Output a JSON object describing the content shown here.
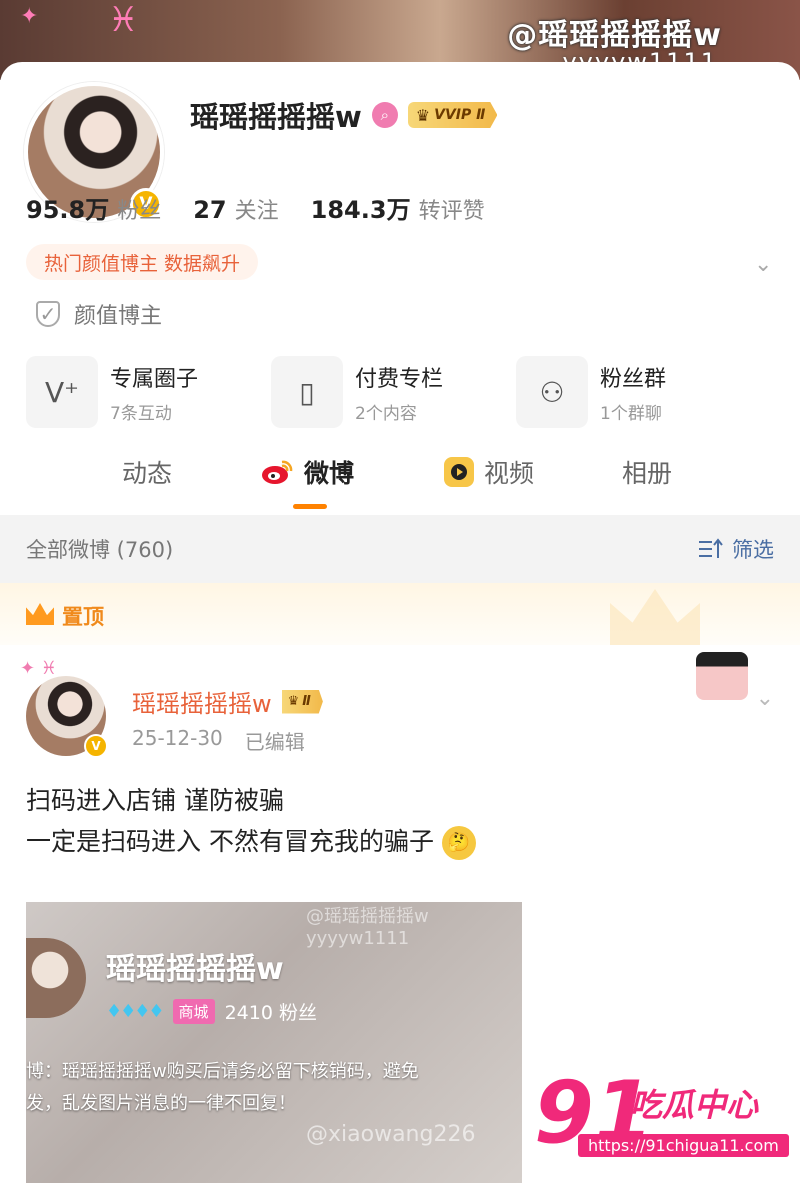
{
  "cover": {
    "watermark_handle": "@瑶瑶摇摇摇w",
    "watermark_id": "yyyyw1111"
  },
  "profile": {
    "name": "瑶瑶摇摇摇w",
    "verified_badge": "V",
    "vip_badge": "VVIP Ⅱ",
    "stats": [
      {
        "value": "95.8万",
        "label": "粉丝"
      },
      {
        "value": "27",
        "label": "关注"
      },
      {
        "value": "184.3万",
        "label": "转评赞"
      }
    ],
    "hot_tag": "热门颜值博主 数据飙升",
    "tagline": "颜值博主",
    "features": [
      {
        "title": "专属圈子",
        "sub": "7条互动",
        "icon": "circle-v-plus-icon"
      },
      {
        "title": "付费专栏",
        "sub": "2个内容",
        "icon": "bookmark-book-icon"
      },
      {
        "title": "粉丝群",
        "sub": "1个群聊",
        "icon": "group-people-icon"
      }
    ]
  },
  "tabs": [
    {
      "label": "动态"
    },
    {
      "label": "微博",
      "active": true
    },
    {
      "label": "视频"
    },
    {
      "label": "相册"
    }
  ],
  "filter": {
    "all_label": "全部微博 (760)",
    "filter_label": "筛选"
  },
  "pinned": {
    "label": "置顶"
  },
  "post": {
    "author": "瑶瑶摇摇摇w",
    "vip_badge": "Ⅱ",
    "date": "25-12-30",
    "edited": "已编辑",
    "line1": "扫码进入店铺 谨防被骗",
    "line2": "一定是扫码进入 不然有冒充我的骗子",
    "embed": {
      "name": "瑶瑶摇摇摇w",
      "mall_tag": "商城",
      "fans": "2410 粉丝",
      "notice_line1": "博：瑶瑶摇摇摇w购买后请务必留下核销码，避免",
      "notice_line2": "发，乱发图片消息的一律不回复！",
      "watermark_top": "@瑶瑶摇摇摇w yyyyw1111",
      "watermark_bottom": "@xiaowang226"
    }
  },
  "logo": {
    "big": "91",
    "cn": "吃瓜中心",
    "url": "https://91chigua11.com"
  },
  "colors": {
    "accent_orange": "#ff8200",
    "hot_tag_text": "#e8623a",
    "link_blue": "#4a6ea3",
    "logo_pink": "#f0297a"
  }
}
